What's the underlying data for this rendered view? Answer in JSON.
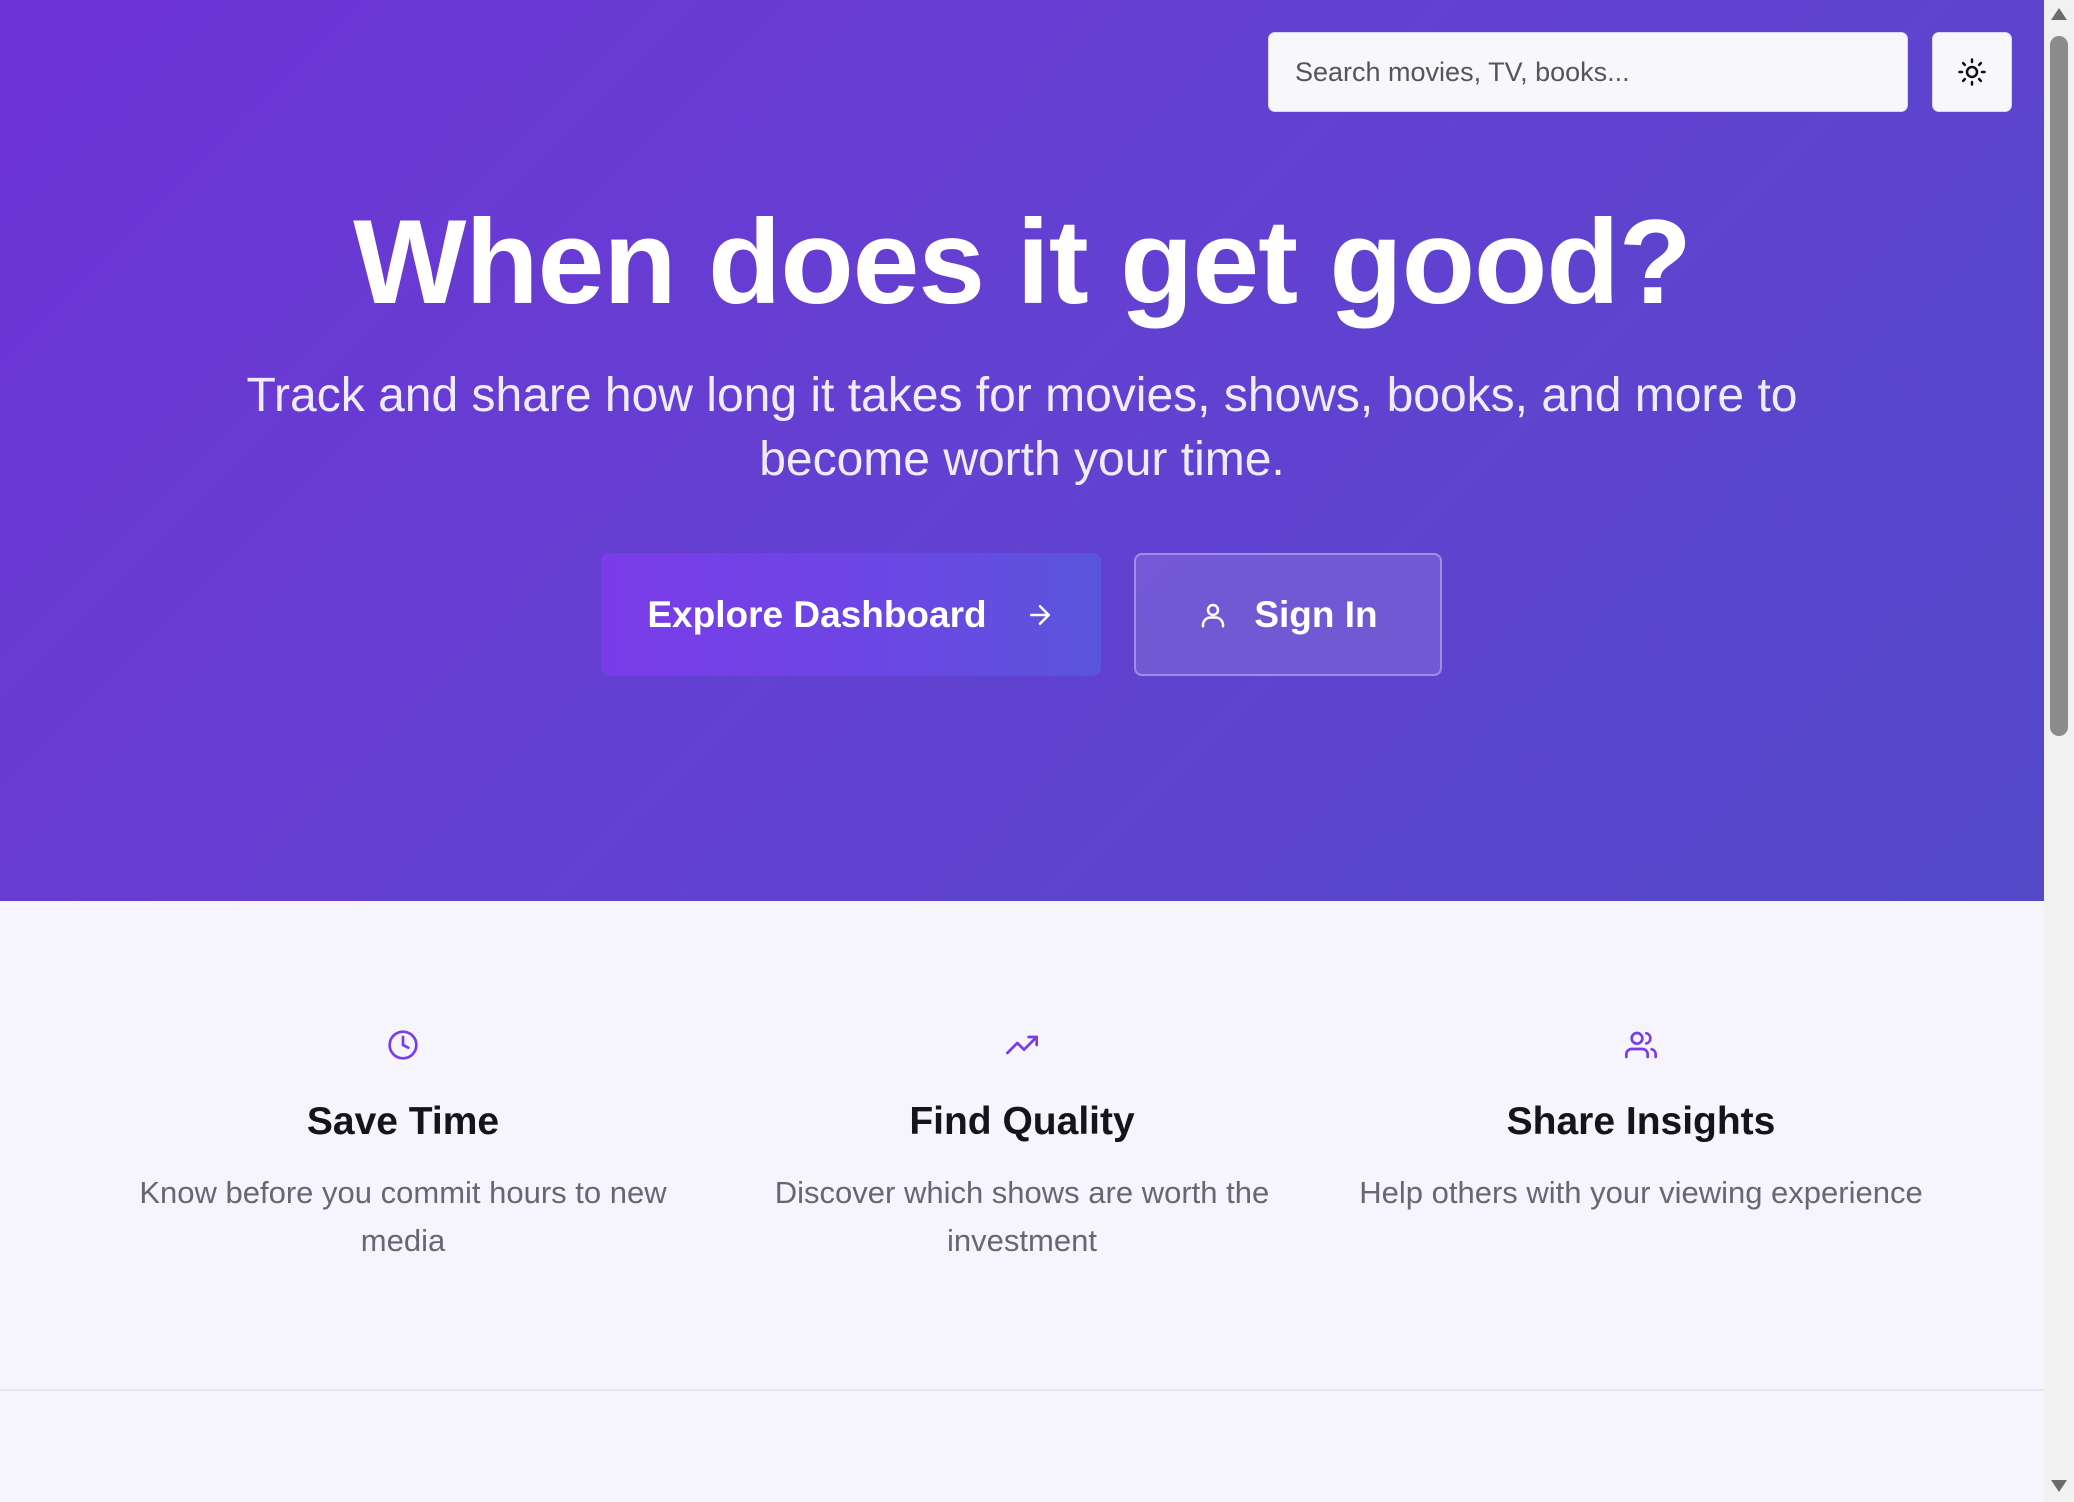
{
  "header": {
    "search_placeholder": "Search movies, TV, books...",
    "theme_toggle_icon": "sun-icon"
  },
  "hero": {
    "title": "When does it get good?",
    "subtitle": "Track and share how long it takes for movies, shows, books, and more to become worth your time.",
    "explore_label": "Explore Dashboard",
    "explore_icon": "arrow-right-icon",
    "signin_label": "Sign In",
    "signin_icon": "user-icon"
  },
  "features": [
    {
      "icon": "clock-icon",
      "title": "Save Time",
      "description": "Know before you commit hours to new media"
    },
    {
      "icon": "trending-up-icon",
      "title": "Find Quality",
      "description": "Discover which shows are worth the investment"
    },
    {
      "icon": "users-icon",
      "title": "Share Insights",
      "description": "Help others with your viewing experience"
    }
  ],
  "colors": {
    "hero_gradient_start": "#6e33d6",
    "hero_gradient_end": "#5349c9",
    "accent": "#7a3be9",
    "page_background": "#f6f4fc"
  }
}
